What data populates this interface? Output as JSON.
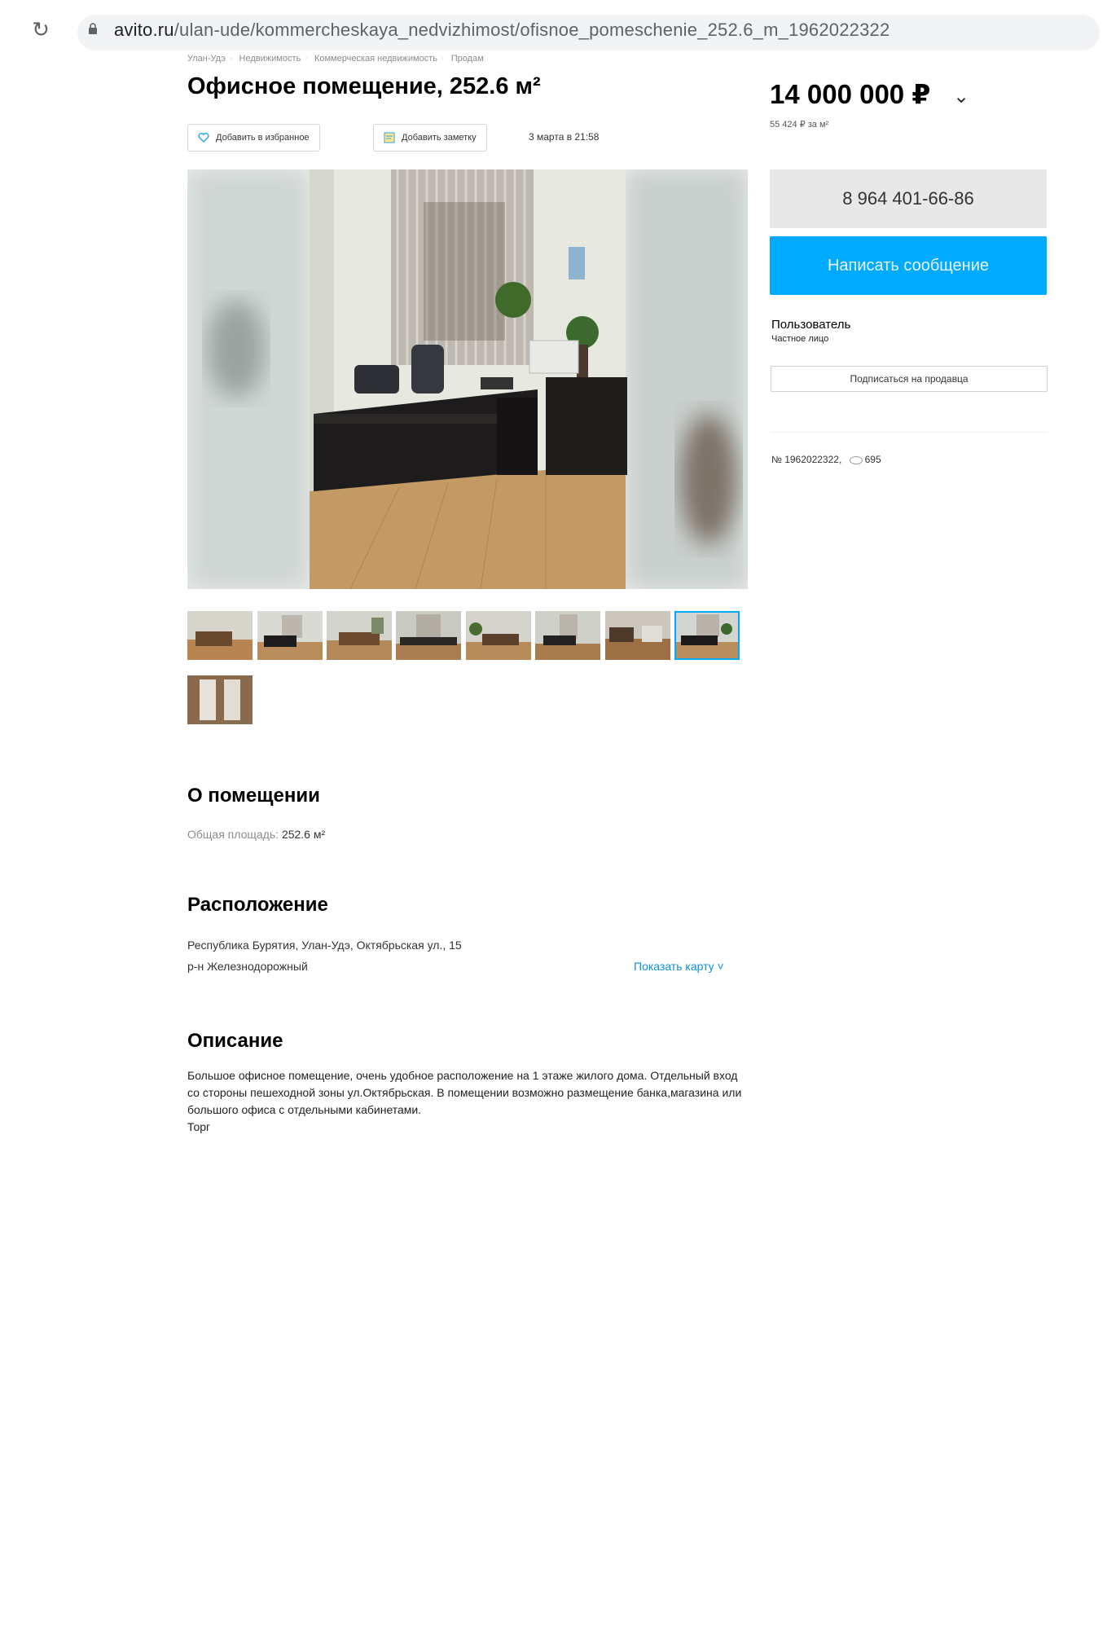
{
  "browser": {
    "url_host": "avito.ru",
    "url_path": "/ulan-ude/kommercheskaya_nedvizhimost/ofisnoe_pomeschenie_252.6_m_1962022322"
  },
  "breadcrumbs": [
    "Улан-Удэ",
    "Недвижимость",
    "Коммерческая недвижимость",
    "Продам"
  ],
  "listing": {
    "title": "Офисное помещение, 252.6 м²",
    "add_favorite_label": "Добавить в избранное",
    "add_note_label": "Добавить заметку",
    "date": "3 марта в 21:58"
  },
  "price": {
    "value": "14 000 000 ₽",
    "per_m2": "55 424 ₽ за м²"
  },
  "contact": {
    "phone": "8 964 401-66-86",
    "message_button": "Написать сообщение"
  },
  "seller": {
    "name": "Пользователь",
    "type": "Частное лицо",
    "subscribe_button": "Подписаться на продавца"
  },
  "meta": {
    "ad_number": "№ 1962022322",
    "views": "695"
  },
  "about": {
    "heading": "О помещении",
    "area_label": "Общая площадь:",
    "area_value": "252.6 м²"
  },
  "location": {
    "heading": "Расположение",
    "address": "Республика Бурятия, Улан-Удэ, Октябрьская ул., 15",
    "district": "р-н Железнодорожный",
    "map_link": "Показать карту"
  },
  "description": {
    "heading": "Описание",
    "text": "Большое офисное помещение, очень удобное расположение на 1 этаже жилого дома. Отдельный вход со стороны пешеходной зоны ул.Октябрьская. В помещении возможно размещение банка,магазина или большого офиса с отдельными кабинетами.",
    "extra": "Торг"
  },
  "colors": {
    "accent": "#00aaff",
    "link": "#0a8ed8",
    "phone_bg": "#e8e8e8"
  },
  "gallery": {
    "thumb_count": 9,
    "selected_thumb": 8
  }
}
